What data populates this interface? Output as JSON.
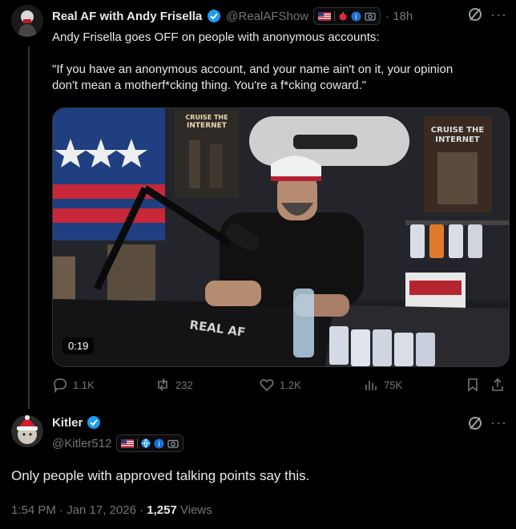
{
  "tweet": {
    "author_name": "Real AF with Andy Frisella",
    "handle": "@RealAFShow",
    "time": "· 18h",
    "text_line1": "Andy Frisella goes OFF on people with anonymous accounts:",
    "quote_line1": "\"If you have an anonymous account, and your name ain't on it, your opinion",
    "quote_line2": "don't mean a motherf*cking thing. You're a f*cking coward.\"",
    "video": {
      "duration": "0:19",
      "desk_logo": "REAL AF",
      "poster1_text": "CRUISE THE INTERNET",
      "poster2_text": "CRUISE THE INTERNET"
    },
    "stats": {
      "replies": "1.1K",
      "reposts": "232",
      "likes": "1.2K",
      "views": "75K"
    }
  },
  "reply": {
    "author_name": "Kitler",
    "handle": "@Kitler512",
    "text": "Only people with approved talking points say this.",
    "time": "1:54 PM · Jan 17, 2026 ·",
    "views_count": "1,257",
    "views_label": "Views"
  },
  "colors": {
    "background": "#000000",
    "text": "#e7e9ea",
    "secondary": "#71767b",
    "verified": "#1d9bf0",
    "divider": "#2f3336"
  }
}
